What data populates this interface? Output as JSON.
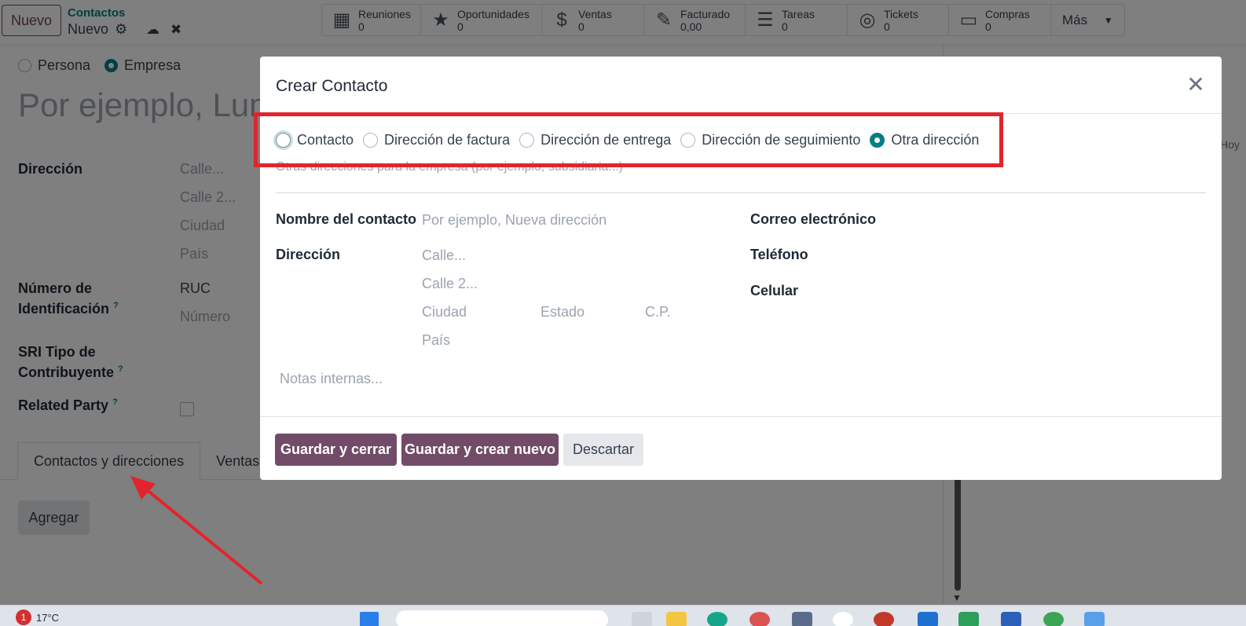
{
  "topbar": {
    "new_button": "Nuevo",
    "breadcrumb_parent": "Contactos",
    "breadcrumb_current": "Nuevo",
    "smart_buttons": [
      {
        "label": "Reuniones",
        "value": "0",
        "icon": "calendar-icon"
      },
      {
        "label": "Oportunidades",
        "value": "0",
        "icon": "star-icon"
      },
      {
        "label": "Ventas",
        "value": "0",
        "icon": "dollar-icon"
      },
      {
        "label": "Facturado",
        "value": "0,00",
        "icon": "edit-icon"
      },
      {
        "label": "Tareas",
        "value": "0",
        "icon": "tasks-icon"
      },
      {
        "label": "Tickets",
        "value": "0",
        "icon": "lifebuoy-icon"
      },
      {
        "label": "Compras",
        "value": "0",
        "icon": "credit-card-icon"
      }
    ],
    "more_label": "Más"
  },
  "background_form": {
    "type_person": "Persona",
    "type_company": "Empresa",
    "name_placeholder": "Por ejemplo, Lum",
    "address_label": "Dirección",
    "street_ph": "Calle...",
    "street2_ph": "Calle 2...",
    "city_ph": "Ciudad",
    "country_ph": "País",
    "id_label_1": "Número de",
    "id_label_2": "Identificación",
    "id_type": "RUC",
    "id_number_ph": "Número",
    "sri_label_1": "SRI Tipo de",
    "sri_label_2": "Contribuyente",
    "related_label": "Related Party",
    "help_mark": "?",
    "tabs": [
      "Contactos y direcciones",
      "Ventas y"
    ],
    "add_button": "Agregar",
    "chatter_today": "Hoy"
  },
  "modal": {
    "title": "Crear Contacto",
    "address_types": [
      {
        "label": "Contacto",
        "selected": false
      },
      {
        "label": "Dirección de factura",
        "selected": false
      },
      {
        "label": "Dirección de entrega",
        "selected": false
      },
      {
        "label": "Dirección de seguimiento",
        "selected": false
      },
      {
        "label": "Otra dirección",
        "selected": true
      }
    ],
    "type_help": "Otras direcciones para la empresa (por ejemplo, subsidiaria...)",
    "contact_name_label": "Nombre del contacto",
    "contact_name_ph": "Por ejemplo, Nueva dirección",
    "address_label": "Dirección",
    "street_ph": "Calle...",
    "street2_ph": "Calle 2...",
    "city_ph": "Ciudad",
    "state_ph": "Estado",
    "zip_ph": "C.P.",
    "country_ph": "País",
    "email_label": "Correo electrónico",
    "phone_label": "Teléfono",
    "mobile_label": "Celular",
    "notes_ph": "Notas internas...",
    "save_close": "Guardar y cerrar",
    "save_new": "Guardar y crear nuevo",
    "discard": "Descartar"
  },
  "taskbar": {
    "notification_count": "1",
    "temperature": "17°C"
  },
  "colors": {
    "brand": "#714b67",
    "accent": "#017e84",
    "annotation": "#e3242b"
  }
}
